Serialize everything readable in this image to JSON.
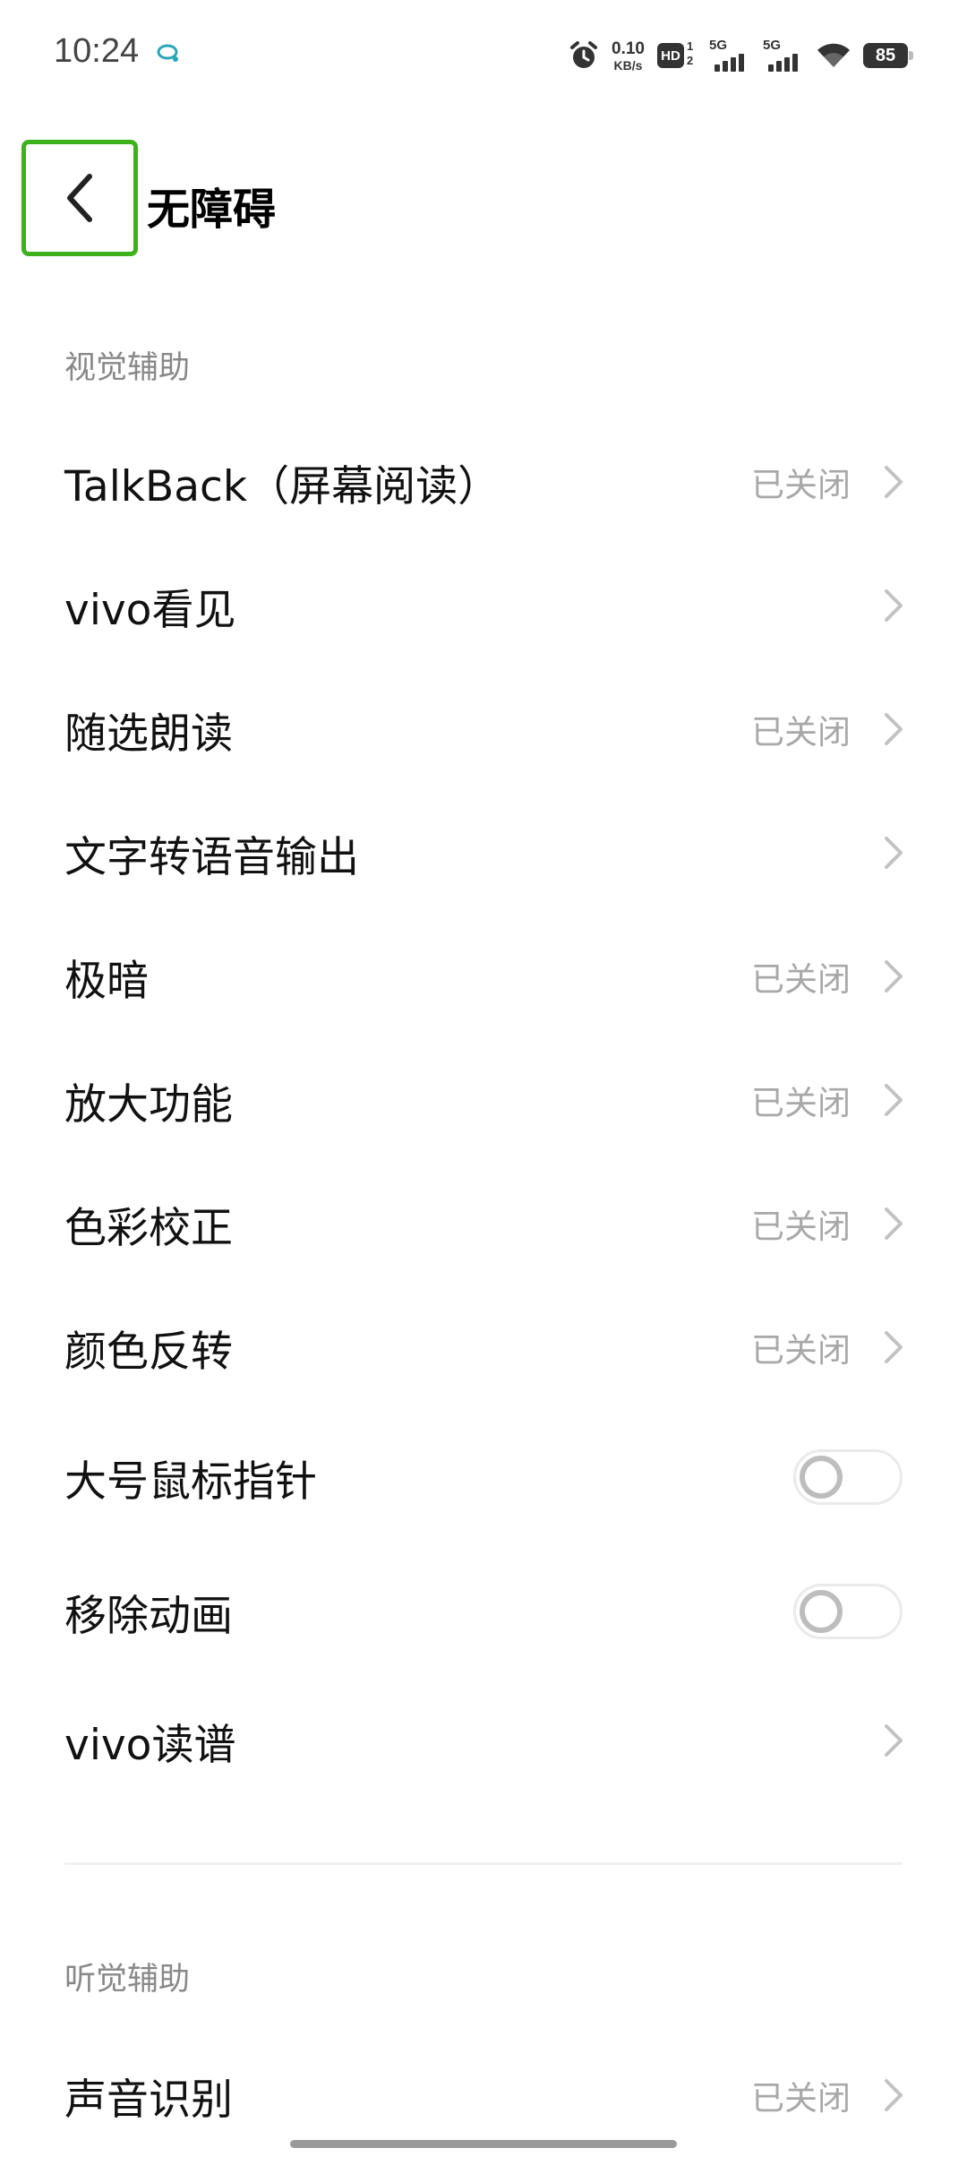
{
  "status_bar": {
    "time": "10:24",
    "net_speed_value": "0.10",
    "net_speed_unit": "KB/s",
    "hd_label": "HD",
    "hd_sup": "1",
    "hd_sub": "2",
    "sim1_label": "5G",
    "sim2_label": "5G",
    "battery_level": "85",
    "icons": [
      "assistant-bubble-icon",
      "alarm-icon",
      "wifi-icon",
      "battery-icon"
    ]
  },
  "header": {
    "title": "无障碍",
    "back_icon": "chevron-left-icon",
    "back_highlight_color": "#3cb11c"
  },
  "sections": [
    {
      "label": "视觉辅助",
      "items": [
        {
          "title": "TalkBack（屏幕阅读）",
          "status": "已关闭",
          "control": "chevron"
        },
        {
          "title": "vivo看见",
          "status": "",
          "control": "chevron"
        },
        {
          "title": "随选朗读",
          "status": "已关闭",
          "control": "chevron"
        },
        {
          "title": "文字转语音输出",
          "status": "",
          "control": "chevron"
        },
        {
          "title": "极暗",
          "status": "已关闭",
          "control": "chevron"
        },
        {
          "title": "放大功能",
          "status": "已关闭",
          "control": "chevron"
        },
        {
          "title": "色彩校正",
          "status": "已关闭",
          "control": "chevron"
        },
        {
          "title": "颜色反转",
          "status": "已关闭",
          "control": "chevron"
        },
        {
          "title": "大号鼠标指针",
          "status": "",
          "control": "toggle",
          "on": false
        },
        {
          "title": "移除动画",
          "status": "",
          "control": "toggle",
          "on": false
        },
        {
          "title": "vivo读谱",
          "status": "",
          "control": "chevron"
        }
      ]
    },
    {
      "label": "听觉辅助",
      "items": [
        {
          "title": "声音识别",
          "status": "已关闭",
          "control": "chevron"
        }
      ]
    }
  ],
  "colors": {
    "text_primary": "#111111",
    "text_secondary": "#a8a8a8",
    "section_label": "#888888"
  }
}
